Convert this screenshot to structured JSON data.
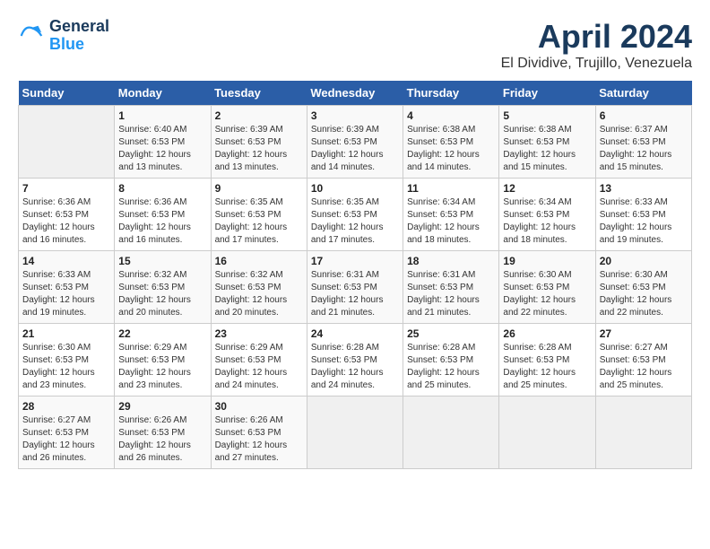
{
  "header": {
    "logo_line1": "General",
    "logo_line2": "Blue",
    "month_title": "April 2024",
    "subtitle": "El Dividive, Trujillo, Venezuela"
  },
  "weekdays": [
    "Sunday",
    "Monday",
    "Tuesday",
    "Wednesday",
    "Thursday",
    "Friday",
    "Saturday"
  ],
  "weeks": [
    [
      {
        "day": "",
        "sunrise": "",
        "sunset": "",
        "daylight": ""
      },
      {
        "day": "1",
        "sunrise": "Sunrise: 6:40 AM",
        "sunset": "Sunset: 6:53 PM",
        "daylight": "Daylight: 12 hours and 13 minutes."
      },
      {
        "day": "2",
        "sunrise": "Sunrise: 6:39 AM",
        "sunset": "Sunset: 6:53 PM",
        "daylight": "Daylight: 12 hours and 13 minutes."
      },
      {
        "day": "3",
        "sunrise": "Sunrise: 6:39 AM",
        "sunset": "Sunset: 6:53 PM",
        "daylight": "Daylight: 12 hours and 14 minutes."
      },
      {
        "day": "4",
        "sunrise": "Sunrise: 6:38 AM",
        "sunset": "Sunset: 6:53 PM",
        "daylight": "Daylight: 12 hours and 14 minutes."
      },
      {
        "day": "5",
        "sunrise": "Sunrise: 6:38 AM",
        "sunset": "Sunset: 6:53 PM",
        "daylight": "Daylight: 12 hours and 15 minutes."
      },
      {
        "day": "6",
        "sunrise": "Sunrise: 6:37 AM",
        "sunset": "Sunset: 6:53 PM",
        "daylight": "Daylight: 12 hours and 15 minutes."
      }
    ],
    [
      {
        "day": "7",
        "sunrise": "Sunrise: 6:36 AM",
        "sunset": "Sunset: 6:53 PM",
        "daylight": "Daylight: 12 hours and 16 minutes."
      },
      {
        "day": "8",
        "sunrise": "Sunrise: 6:36 AM",
        "sunset": "Sunset: 6:53 PM",
        "daylight": "Daylight: 12 hours and 16 minutes."
      },
      {
        "day": "9",
        "sunrise": "Sunrise: 6:35 AM",
        "sunset": "Sunset: 6:53 PM",
        "daylight": "Daylight: 12 hours and 17 minutes."
      },
      {
        "day": "10",
        "sunrise": "Sunrise: 6:35 AM",
        "sunset": "Sunset: 6:53 PM",
        "daylight": "Daylight: 12 hours and 17 minutes."
      },
      {
        "day": "11",
        "sunrise": "Sunrise: 6:34 AM",
        "sunset": "Sunset: 6:53 PM",
        "daylight": "Daylight: 12 hours and 18 minutes."
      },
      {
        "day": "12",
        "sunrise": "Sunrise: 6:34 AM",
        "sunset": "Sunset: 6:53 PM",
        "daylight": "Daylight: 12 hours and 18 minutes."
      },
      {
        "day": "13",
        "sunrise": "Sunrise: 6:33 AM",
        "sunset": "Sunset: 6:53 PM",
        "daylight": "Daylight: 12 hours and 19 minutes."
      }
    ],
    [
      {
        "day": "14",
        "sunrise": "Sunrise: 6:33 AM",
        "sunset": "Sunset: 6:53 PM",
        "daylight": "Daylight: 12 hours and 19 minutes."
      },
      {
        "day": "15",
        "sunrise": "Sunrise: 6:32 AM",
        "sunset": "Sunset: 6:53 PM",
        "daylight": "Daylight: 12 hours and 20 minutes."
      },
      {
        "day": "16",
        "sunrise": "Sunrise: 6:32 AM",
        "sunset": "Sunset: 6:53 PM",
        "daylight": "Daylight: 12 hours and 20 minutes."
      },
      {
        "day": "17",
        "sunrise": "Sunrise: 6:31 AM",
        "sunset": "Sunset: 6:53 PM",
        "daylight": "Daylight: 12 hours and 21 minutes."
      },
      {
        "day": "18",
        "sunrise": "Sunrise: 6:31 AM",
        "sunset": "Sunset: 6:53 PM",
        "daylight": "Daylight: 12 hours and 21 minutes."
      },
      {
        "day": "19",
        "sunrise": "Sunrise: 6:30 AM",
        "sunset": "Sunset: 6:53 PM",
        "daylight": "Daylight: 12 hours and 22 minutes."
      },
      {
        "day": "20",
        "sunrise": "Sunrise: 6:30 AM",
        "sunset": "Sunset: 6:53 PM",
        "daylight": "Daylight: 12 hours and 22 minutes."
      }
    ],
    [
      {
        "day": "21",
        "sunrise": "Sunrise: 6:30 AM",
        "sunset": "Sunset: 6:53 PM",
        "daylight": "Daylight: 12 hours and 23 minutes."
      },
      {
        "day": "22",
        "sunrise": "Sunrise: 6:29 AM",
        "sunset": "Sunset: 6:53 PM",
        "daylight": "Daylight: 12 hours and 23 minutes."
      },
      {
        "day": "23",
        "sunrise": "Sunrise: 6:29 AM",
        "sunset": "Sunset: 6:53 PM",
        "daylight": "Daylight: 12 hours and 24 minutes."
      },
      {
        "day": "24",
        "sunrise": "Sunrise: 6:28 AM",
        "sunset": "Sunset: 6:53 PM",
        "daylight": "Daylight: 12 hours and 24 minutes."
      },
      {
        "day": "25",
        "sunrise": "Sunrise: 6:28 AM",
        "sunset": "Sunset: 6:53 PM",
        "daylight": "Daylight: 12 hours and 25 minutes."
      },
      {
        "day": "26",
        "sunrise": "Sunrise: 6:28 AM",
        "sunset": "Sunset: 6:53 PM",
        "daylight": "Daylight: 12 hours and 25 minutes."
      },
      {
        "day": "27",
        "sunrise": "Sunrise: 6:27 AM",
        "sunset": "Sunset: 6:53 PM",
        "daylight": "Daylight: 12 hours and 25 minutes."
      }
    ],
    [
      {
        "day": "28",
        "sunrise": "Sunrise: 6:27 AM",
        "sunset": "Sunset: 6:53 PM",
        "daylight": "Daylight: 12 hours and 26 minutes."
      },
      {
        "day": "29",
        "sunrise": "Sunrise: 6:26 AM",
        "sunset": "Sunset: 6:53 PM",
        "daylight": "Daylight: 12 hours and 26 minutes."
      },
      {
        "day": "30",
        "sunrise": "Sunrise: 6:26 AM",
        "sunset": "Sunset: 6:53 PM",
        "daylight": "Daylight: 12 hours and 27 minutes."
      },
      {
        "day": "",
        "sunrise": "",
        "sunset": "",
        "daylight": ""
      },
      {
        "day": "",
        "sunrise": "",
        "sunset": "",
        "daylight": ""
      },
      {
        "day": "",
        "sunrise": "",
        "sunset": "",
        "daylight": ""
      },
      {
        "day": "",
        "sunrise": "",
        "sunset": "",
        "daylight": ""
      }
    ]
  ]
}
